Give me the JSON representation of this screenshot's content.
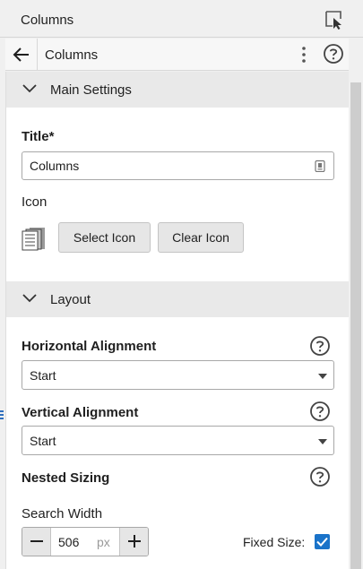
{
  "titlebar": {
    "title": "Columns",
    "icon": "cursor-select-icon"
  },
  "navbar": {
    "title": "Columns",
    "back_icon": "arrow-left-icon",
    "menu_icon": "kebab-icon",
    "help_icon": "help-icon"
  },
  "main_settings": {
    "header": "Main Settings",
    "title_label": "Title*",
    "title_value": "Columns",
    "icon_label": "Icon",
    "select_icon_label": "Select Icon",
    "clear_icon_label": "Clear Icon"
  },
  "layout": {
    "header": "Layout",
    "horizontal_alignment_label": "Horizontal Alignment",
    "horizontal_alignment_value": "Start",
    "vertical_alignment_label": "Vertical Alignment",
    "vertical_alignment_value": "Start",
    "nested_sizing_label": "Nested Sizing",
    "search_width_label": "Search Width",
    "search_width_value": "506",
    "search_width_unit": "px",
    "fixed_size_label": "Fixed Size:",
    "fixed_size_checked": true
  },
  "colors": {
    "accent": "#1a73c9",
    "section_bg": "#e9e9e9",
    "button_bg": "#e6e6e6"
  }
}
